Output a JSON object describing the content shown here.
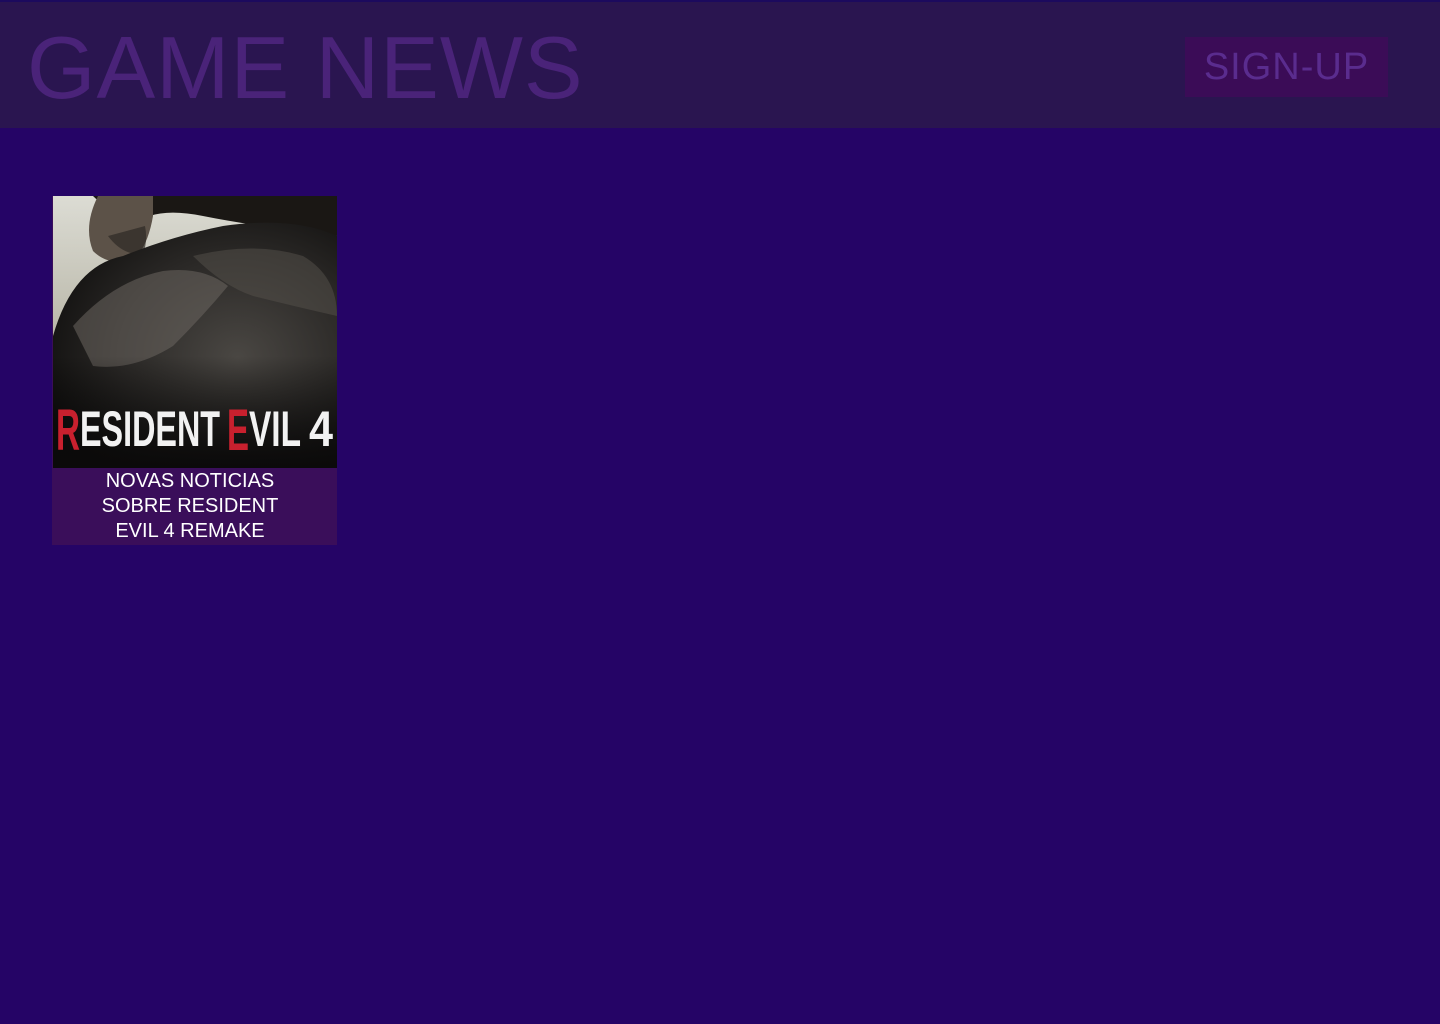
{
  "header": {
    "title": "GAME NEWS",
    "signup_label": "SIGN-UP"
  },
  "colors": {
    "page_background": "#250466",
    "header_background": "#2a1550",
    "title_text": "#4a2379",
    "button_background": "#3b0c57",
    "button_text": "#5a2c8e",
    "card_caption_background": "#3a0e5a"
  },
  "news": [
    {
      "cover_title": "RESIDENT EVIL 4",
      "caption": "NOVAS NOTICIAS SOBRE RESIDENT EVIL 4 REMAKE"
    }
  ]
}
